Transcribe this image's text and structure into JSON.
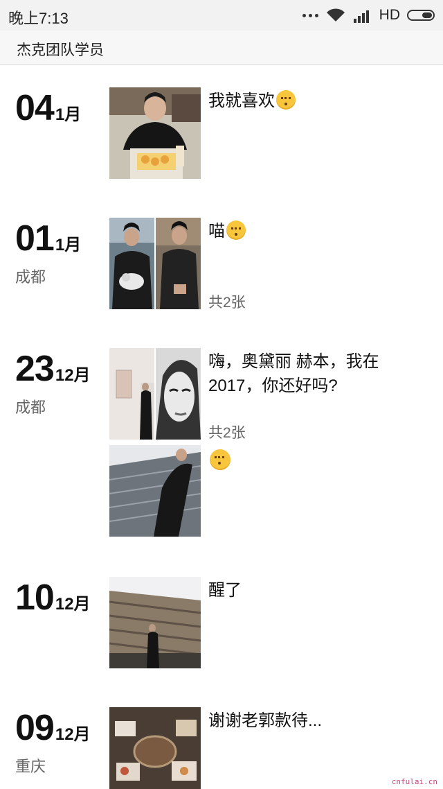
{
  "status_bar": {
    "time": "晚上7:13",
    "network": "HD"
  },
  "header": {
    "title": "杰克团队学员"
  },
  "entries": [
    {
      "day": "04",
      "month": "1月",
      "location": "",
      "caption": "我就喜欢",
      "count": ""
    },
    {
      "day": "01",
      "month": "1月",
      "location": "成都",
      "caption": "喵",
      "count": "共2张"
    },
    {
      "day": "23",
      "month": "12月",
      "location": "成都",
      "caption": "嗨，奥黛丽 赫本，我在2017，你还好吗?",
      "count": "共2张"
    },
    {
      "day": "10",
      "month": "12月",
      "location": "",
      "caption": "醒了",
      "count": ""
    },
    {
      "day": "09",
      "month": "12月",
      "location": "重庆",
      "caption": "谢谢老郭款待...",
      "count": ""
    }
  ],
  "watermark": "cnfulai.cn",
  "icons": [
    "signal-dots-icon",
    "wifi-icon",
    "cell-signal-icon",
    "battery-icon",
    "smile-emoji-icon"
  ]
}
